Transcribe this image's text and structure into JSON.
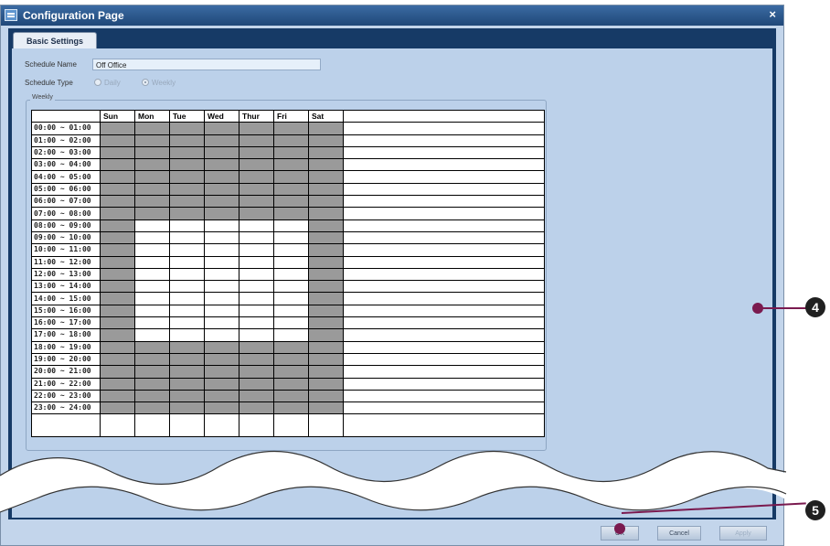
{
  "window": {
    "title": "Configuration Page",
    "close_label": "×"
  },
  "tab": {
    "label": "Basic Settings"
  },
  "form": {
    "schedule_name_label": "Schedule Name",
    "schedule_name_value": "Off Office",
    "schedule_type_label": "Schedule Type",
    "type_option_daily": "Daily",
    "type_option_weekly": "Weekly",
    "weekly_group_label": "Weekly"
  },
  "schedule": {
    "days": [
      "Sun",
      "Mon",
      "Tue",
      "Wed",
      "Thur",
      "Fri",
      "Sat"
    ],
    "times": [
      "00:00 ~ 01:00",
      "01:00 ~ 02:00",
      "02:00 ~ 03:00",
      "03:00 ~ 04:00",
      "04:00 ~ 05:00",
      "05:00 ~ 06:00",
      "06:00 ~ 07:00",
      "07:00 ~ 08:00",
      "08:00 ~ 09:00",
      "09:00 ~ 10:00",
      "10:00 ~ 11:00",
      "11:00 ~ 12:00",
      "12:00 ~ 13:00",
      "13:00 ~ 14:00",
      "14:00 ~ 15:00",
      "15:00 ~ 16:00",
      "16:00 ~ 17:00",
      "17:00 ~ 18:00",
      "18:00 ~ 19:00",
      "19:00 ~ 20:00",
      "20:00 ~ 21:00",
      "21:00 ~ 22:00",
      "22:00 ~ 23:00",
      "23:00 ~ 24:00"
    ],
    "selected": [
      [
        1,
        1,
        1,
        1,
        1,
        1,
        1
      ],
      [
        1,
        1,
        1,
        1,
        1,
        1,
        1
      ],
      [
        1,
        1,
        1,
        1,
        1,
        1,
        1
      ],
      [
        1,
        1,
        1,
        1,
        1,
        1,
        1
      ],
      [
        1,
        1,
        1,
        1,
        1,
        1,
        1
      ],
      [
        1,
        1,
        1,
        1,
        1,
        1,
        1
      ],
      [
        1,
        1,
        1,
        1,
        1,
        1,
        1
      ],
      [
        1,
        1,
        1,
        1,
        1,
        1,
        1
      ],
      [
        1,
        0,
        0,
        0,
        0,
        0,
        1
      ],
      [
        1,
        0,
        0,
        0,
        0,
        0,
        1
      ],
      [
        1,
        0,
        0,
        0,
        0,
        0,
        1
      ],
      [
        1,
        0,
        0,
        0,
        0,
        0,
        1
      ],
      [
        1,
        0,
        0,
        0,
        0,
        0,
        1
      ],
      [
        1,
        0,
        0,
        0,
        0,
        0,
        1
      ],
      [
        1,
        0,
        0,
        0,
        0,
        0,
        1
      ],
      [
        1,
        0,
        0,
        0,
        0,
        0,
        1
      ],
      [
        1,
        0,
        0,
        0,
        0,
        0,
        1
      ],
      [
        1,
        0,
        0,
        0,
        0,
        0,
        1
      ],
      [
        1,
        1,
        1,
        1,
        1,
        1,
        1
      ],
      [
        1,
        1,
        1,
        1,
        1,
        1,
        1
      ],
      [
        1,
        1,
        1,
        1,
        1,
        1,
        1
      ],
      [
        1,
        1,
        1,
        1,
        1,
        1,
        1
      ],
      [
        1,
        1,
        1,
        1,
        1,
        1,
        1
      ],
      [
        1,
        1,
        1,
        1,
        1,
        1,
        1
      ]
    ],
    "selected_color": "#9a9a9a"
  },
  "buttons": {
    "ok": "OK",
    "cancel": "Cancel",
    "apply": "Apply"
  },
  "callouts": {
    "four": "4",
    "five": "5",
    "color": "#7a1a4f"
  }
}
